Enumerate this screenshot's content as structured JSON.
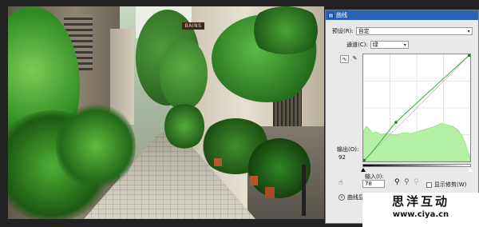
{
  "photo": {
    "sign_text": "BAINS"
  },
  "dialog": {
    "title": "曲线",
    "preset_label": "预设(R):",
    "preset_value": "自定",
    "channel_label": "通道(C):",
    "channel_value": "绿",
    "output_label": "输出(O):",
    "output_value": "92",
    "input_label": "输入(I):",
    "input_value": "78",
    "show_clipping_label": "显示修剪(W)",
    "options_label": "曲线显示选",
    "accent_color": "#2a62b8",
    "histogram_color": "#b4f0a4",
    "curve_color": "#2fae3a"
  },
  "watermark": {
    "line1": "思洋互动",
    "line2": "www.ciya.cn"
  }
}
